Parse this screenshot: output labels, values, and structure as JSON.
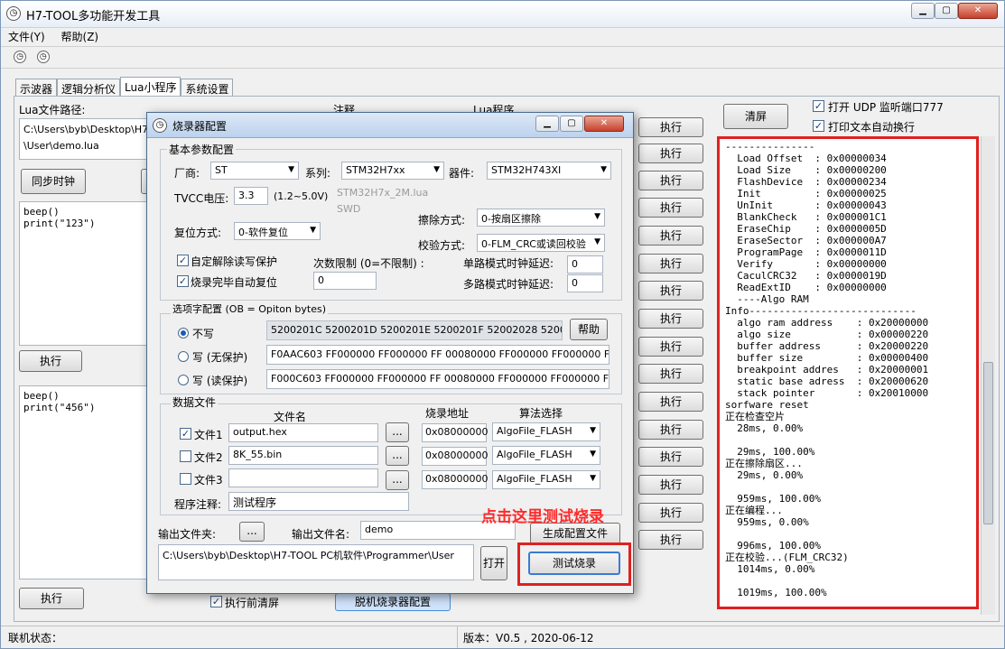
{
  "window": {
    "title": "H7-TOOL多功能开发工具",
    "min": "▁",
    "max": "▢",
    "close": "✕"
  },
  "menu": [
    "文件(Y)",
    "帮助(Z)"
  ],
  "tabs": [
    "示波器",
    "逻辑分析仪",
    "Lua小程序",
    "系统设置"
  ],
  "left": {
    "path_label": "Lua文件路径:",
    "path_value_1": "C:\\Users\\byb\\Desktop\\H7-T",
    "path_value_2": "\\User\\demo.lua",
    "sync_clock": "同步时钟",
    "code1": "beep()\nprint(\"123\")",
    "exec1": "执行",
    "code2": "beep()\nprint(\"456\")",
    "exec2": "执行",
    "clear_before": "执行前清屏",
    "bottom_btn": "脱机烧录器配置"
  },
  "mid": {
    "col_note": "注释",
    "col_lua": "Lua程序",
    "exec": "执行"
  },
  "right": {
    "clear": "清屏",
    "udp": "打开 UDP 监听端口777",
    "autowrap": "打印文本自动换行",
    "log": "---------------\n  Load Offset  : 0x00000034\n  Load Size    : 0x00000200\n  FlashDevice  : 0x00000234\n  Init         : 0x00000025\n  UnInit       : 0x00000043\n  BlankCheck   : 0x000001C1\n  EraseChip    : 0x0000005D\n  EraseSector  : 0x000000A7\n  ProgramPage  : 0x0000011D\n  Verify       : 0x00000000\n  CaculCRC32   : 0x0000019D\n  ReadExtID    : 0x00000000\n  ----Algo RAM\nInfo----------------------------\n  algo ram address    : 0x20000000\n  algo size           : 0x00000220\n  buffer address      : 0x20000220\n  buffer size         : 0x00000400\n  breakpoint addres   : 0x20000001\n  static base adress  : 0x20000620\n  stack pointer       : 0x20010000\nsorfware reset\n正在检查空片\n  28ms, 0.00%\n\n  29ms, 100.00%\n正在擦除扇区...\n  29ms, 0.00%\n\n  959ms, 100.00%\n正在编程...\n  959ms, 0.00%\n\n  996ms, 100.00%\n正在校验...(FLM_CRC32)\n  1014ms, 0.00%\n\n  1019ms, 100.00%"
  },
  "status": {
    "conn": "联机状态：",
    "version": "版本：V0.5 , 2020-06-12"
  },
  "dialog": {
    "title": "烧录器配置",
    "basic": "基本参数配置",
    "vendor_lbl": "厂商:",
    "vendor": "ST",
    "series_lbl": "系列:",
    "series": "STM32H7xx",
    "device_lbl": "器件:",
    "device": "STM32H743XI",
    "tvcc_lbl": "TVCC电压:",
    "tvcc": "3.3",
    "tvcc_range": "(1.2~5.0V)",
    "lua_file": "STM32H7x_2M.lua",
    "swd": "SWD",
    "reset_lbl": "复位方式:",
    "reset": "0-软件复位",
    "erase_lbl": "擦除方式:",
    "erase": "0-按扇区擦除",
    "verify_lbl": "校验方式:",
    "verify": "0-FLM_CRC或读回校验",
    "auto_unlock": "自定解除读写保护",
    "auto_reset": "烧录完毕自动复位",
    "limit_lbl": "次数限制 (0=不限制) :",
    "limit": "0",
    "single_delay_lbl": "单路模式时钟延迟:",
    "single_delay": "0",
    "multi_delay_lbl": "多路模式时钟延迟:",
    "multi_delay": "0",
    "ob": "选项字配置 (OB = Opiton bytes)",
    "ob_none": "不写",
    "ob_none_val": "5200201C 5200201D 5200201E 5200201F 52002028 52002029 520",
    "help": "帮助",
    "ob_noprot": "写 (无保护)",
    "ob_noprot_val": "F0AAC603  FF000000 FF000000 FF 00080000 FF000000 FF000000 FF",
    "ob_rdprot": "写 (读保护)",
    "ob_rdprot_val": "F000C603  FF000000 FF000000 FF 00080000 FF000000 FF000000 FF",
    "data": "数据文件",
    "col_file": "文件名",
    "col_addr": "烧录地址",
    "col_algo": "算法选择",
    "files": [
      {
        "label": "文件1",
        "name": "output.hex",
        "addr": "0x08000000",
        "algo": "AlgoFile_FLASH",
        "checked": "✓"
      },
      {
        "label": "文件2",
        "name": "8K_55.bin",
        "addr": "0x08000000",
        "algo": "AlgoFile_FLASH",
        "checked": ""
      },
      {
        "label": "文件3",
        "name": "",
        "addr": "0x08000000",
        "algo": "AlgoFile_FLASH",
        "checked": ""
      }
    ],
    "browse": "...",
    "note_lbl": "程序注释:",
    "note": "测试程序",
    "out_dir_lbl": "输出文件夹:",
    "out_name_lbl": "输出文件名:",
    "out_name": "demo",
    "out_path": "C:\\Users\\byb\\Desktop\\H7-TOOL PC机软件\\Programmer\\User",
    "open": "打开",
    "gen": "生成配置文件",
    "test": "测试烧录"
  },
  "annotation": "点击这里测试烧录",
  "colors": {
    "highlight": "#e02020",
    "annotation": "#ff2a2a"
  }
}
